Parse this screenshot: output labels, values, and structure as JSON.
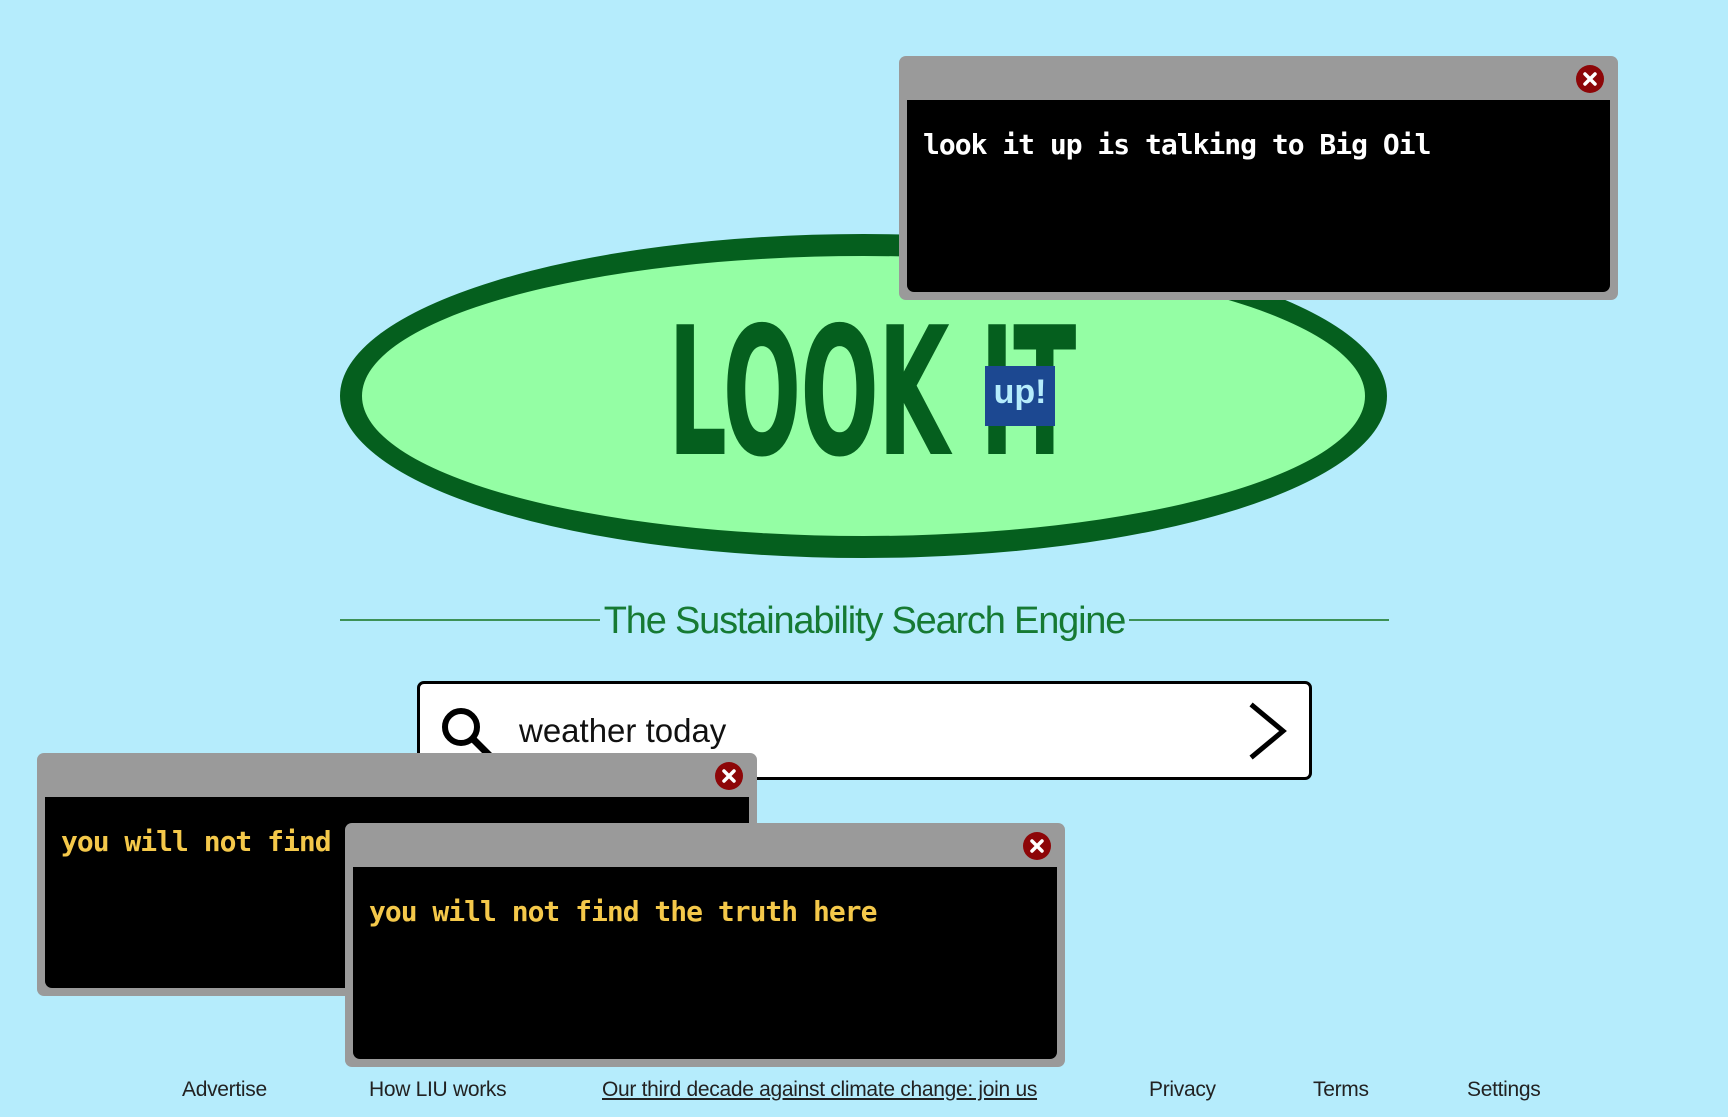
{
  "logo": {
    "word": "LOOK IT",
    "badge": "up!"
  },
  "tagline": "The Sustainability Search Engine",
  "search": {
    "value": "weather today",
    "icon": "search-icon",
    "submit_icon": "chevron-right-icon"
  },
  "popups": [
    {
      "message": "look it up is talking to Big Oil",
      "close_icon": "close-icon"
    },
    {
      "message": "you will not find the truth here",
      "close_icon": "close-icon"
    },
    {
      "message": "you will not find the truth here",
      "close_icon": "close-icon"
    }
  ],
  "footer": {
    "links": [
      "Advertise",
      "How LIU works",
      "Our third decade against climate change: join us",
      "Privacy",
      "Terms",
      "Settings"
    ]
  },
  "colors": {
    "background": "#b5ecfc",
    "logo_fill": "#94fea4",
    "logo_dark": "#055f1e",
    "badge": "#1c4891",
    "popup_frame": "#9a9a9a",
    "popup_close": "#8d0608",
    "popup_warning_text": "#f4c84a"
  }
}
